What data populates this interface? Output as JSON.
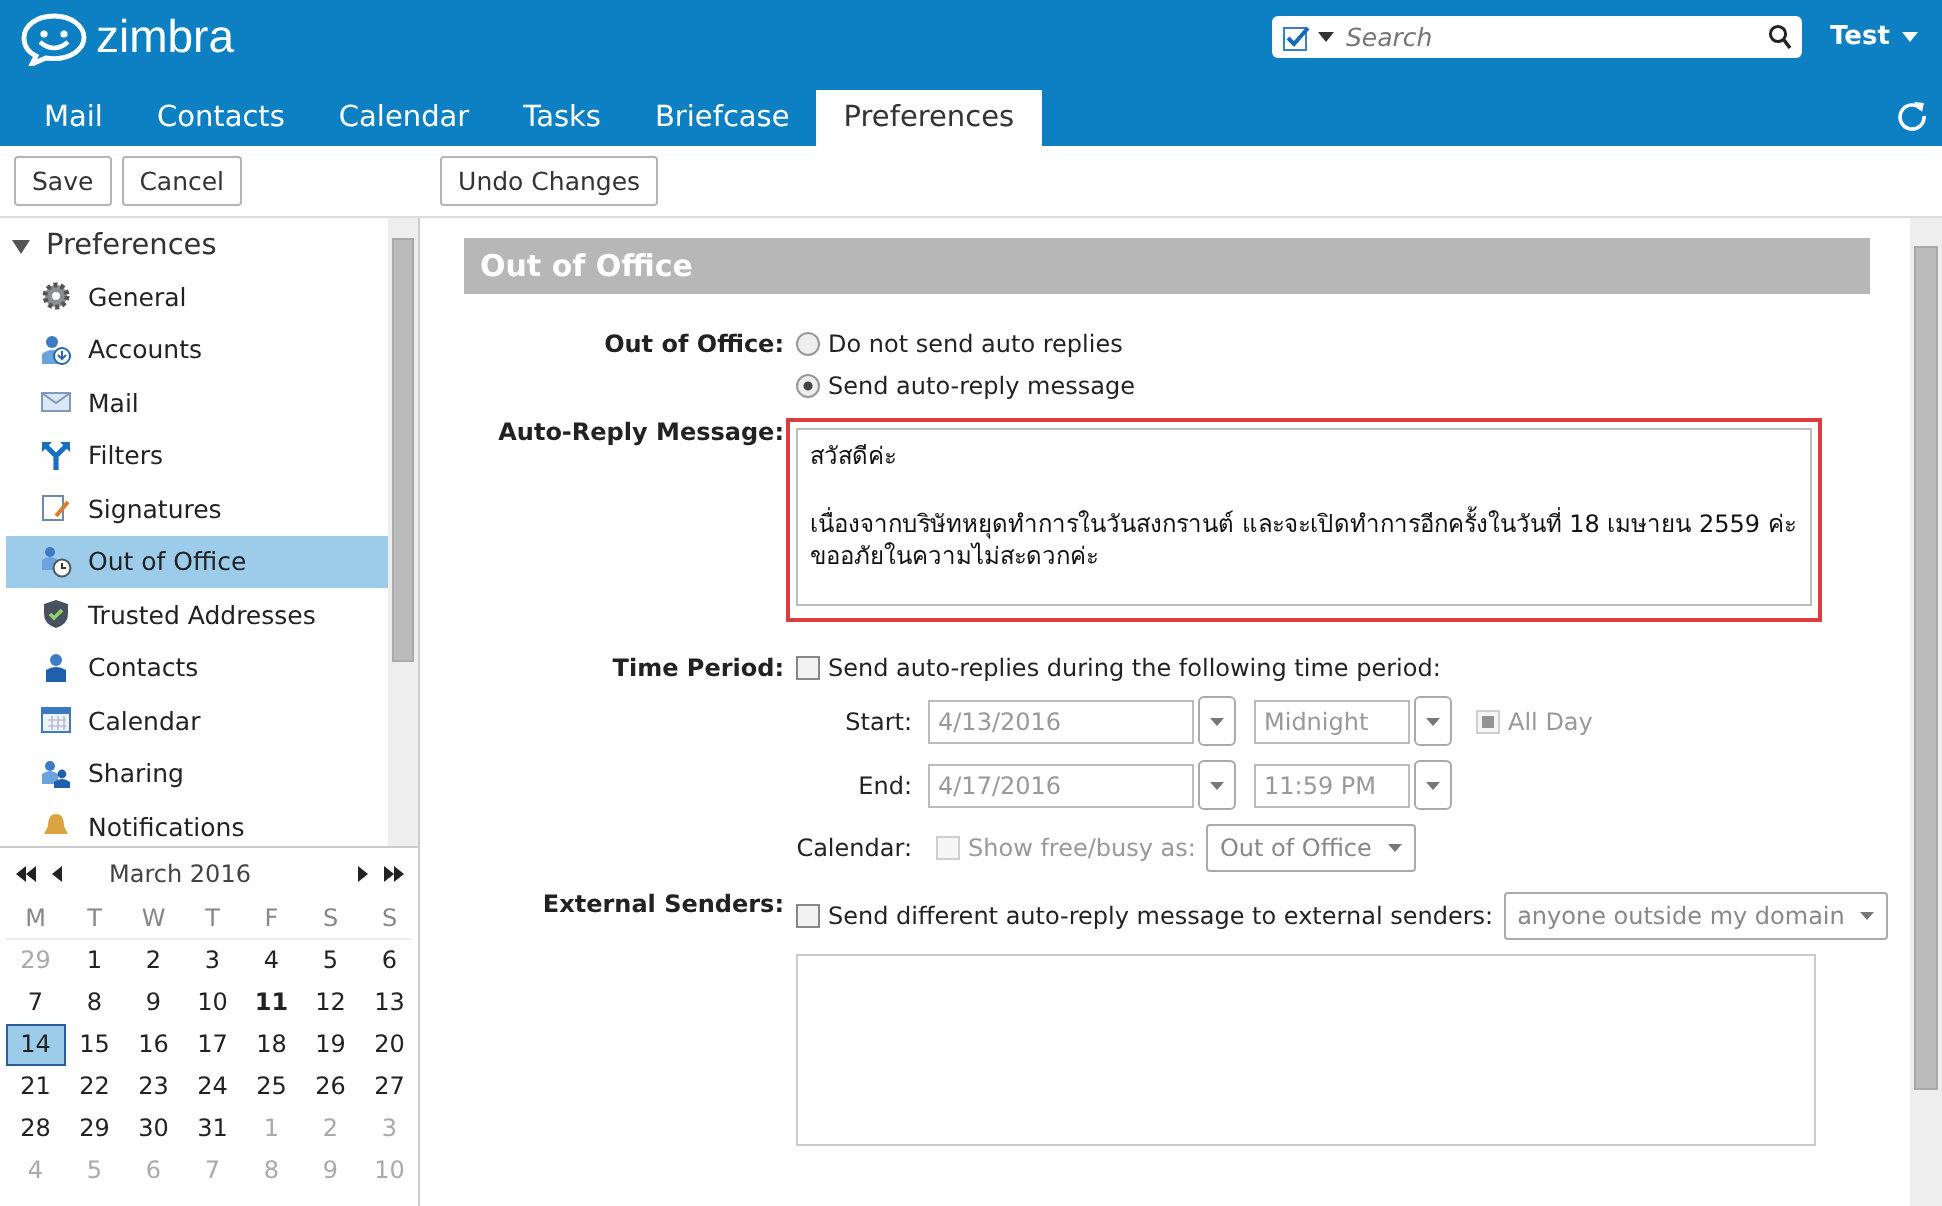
{
  "header": {
    "logo": "zimbra",
    "search": {
      "placeholder": "Search"
    },
    "user": "Test"
  },
  "tabs": [
    {
      "label": "Mail",
      "selected": false
    },
    {
      "label": "Contacts",
      "selected": false
    },
    {
      "label": "Calendar",
      "selected": false
    },
    {
      "label": "Tasks",
      "selected": false
    },
    {
      "label": "Briefcase",
      "selected": false
    },
    {
      "label": "Preferences",
      "selected": true
    }
  ],
  "toolbar": {
    "buttons": [
      "Save",
      "Cancel"
    ],
    "undo": "Undo Changes"
  },
  "sidebar": {
    "title": "Preferences",
    "expanded": true,
    "items": [
      {
        "label": "General",
        "selected": false
      },
      {
        "label": "Accounts",
        "selected": false
      },
      {
        "label": "Mail",
        "selected": false
      },
      {
        "label": "Filters",
        "selected": false
      },
      {
        "label": "Signatures",
        "selected": false
      },
      {
        "label": "Out of Office",
        "selected": true
      },
      {
        "label": "Trusted Addresses",
        "selected": false
      },
      {
        "label": "Contacts",
        "selected": false
      },
      {
        "label": "Calendar",
        "selected": false
      },
      {
        "label": "Sharing",
        "selected": false
      },
      {
        "label": "Notifications",
        "selected": false
      }
    ]
  },
  "mini_calendar": {
    "title": "March 2016",
    "weekdays": [
      "M",
      "T",
      "W",
      "T",
      "F",
      "S",
      "S"
    ],
    "weeks": [
      [
        {
          "day": "29",
          "muted": true,
          "today": false,
          "selected": false
        },
        {
          "day": "1",
          "muted": false,
          "today": false,
          "selected": false
        },
        {
          "day": "2",
          "muted": false,
          "today": false,
          "selected": false
        },
        {
          "day": "3",
          "muted": false,
          "today": false,
          "selected": false
        },
        {
          "day": "4",
          "muted": false,
          "today": false,
          "selected": false
        },
        {
          "day": "5",
          "muted": false,
          "today": false,
          "selected": false
        },
        {
          "day": "6",
          "muted": false,
          "today": false,
          "selected": false
        }
      ],
      [
        {
          "day": "7",
          "muted": false,
          "today": false,
          "selected": false
        },
        {
          "day": "8",
          "muted": false,
          "today": false,
          "selected": false
        },
        {
          "day": "9",
          "muted": false,
          "today": false,
          "selected": false
        },
        {
          "day": "10",
          "muted": false,
          "today": false,
          "selected": false
        },
        {
          "day": "11",
          "muted": false,
          "today": true,
          "selected": false
        },
        {
          "day": "12",
          "muted": false,
          "today": false,
          "selected": false
        },
        {
          "day": "13",
          "muted": false,
          "today": false,
          "selected": false
        }
      ],
      [
        {
          "day": "14",
          "muted": false,
          "today": false,
          "selected": true
        },
        {
          "day": "15",
          "muted": false,
          "today": false,
          "selected": false
        },
        {
          "day": "16",
          "muted": false,
          "today": false,
          "selected": false
        },
        {
          "day": "17",
          "muted": false,
          "today": false,
          "selected": false
        },
        {
          "day": "18",
          "muted": false,
          "today": false,
          "selected": false
        },
        {
          "day": "19",
          "muted": false,
          "today": false,
          "selected": false
        },
        {
          "day": "20",
          "muted": false,
          "today": false,
          "selected": false
        }
      ],
      [
        {
          "day": "21",
          "muted": false,
          "today": false,
          "selected": false
        },
        {
          "day": "22",
          "muted": false,
          "today": false,
          "selected": false
        },
        {
          "day": "23",
          "muted": false,
          "today": false,
          "selected": false
        },
        {
          "day": "24",
          "muted": false,
          "today": false,
          "selected": false
        },
        {
          "day": "25",
          "muted": false,
          "today": false,
          "selected": false
        },
        {
          "day": "26",
          "muted": false,
          "today": false,
          "selected": false
        },
        {
          "day": "27",
          "muted": false,
          "today": false,
          "selected": false
        }
      ],
      [
        {
          "day": "28",
          "muted": false,
          "today": false,
          "selected": false
        },
        {
          "day": "29",
          "muted": false,
          "today": false,
          "selected": false
        },
        {
          "day": "30",
          "muted": false,
          "today": false,
          "selected": false
        },
        {
          "day": "31",
          "muted": false,
          "today": false,
          "selected": false
        },
        {
          "day": "1",
          "muted": true,
          "today": false,
          "selected": false
        },
        {
          "day": "2",
          "muted": true,
          "today": false,
          "selected": false
        },
        {
          "day": "3",
          "muted": true,
          "today": false,
          "selected": false
        }
      ],
      [
        {
          "day": "4",
          "muted": true,
          "today": false,
          "selected": false
        },
        {
          "day": "5",
          "muted": true,
          "today": false,
          "selected": false
        },
        {
          "day": "6",
          "muted": true,
          "today": false,
          "selected": false
        },
        {
          "day": "7",
          "muted": true,
          "today": false,
          "selected": false
        },
        {
          "day": "8",
          "muted": true,
          "today": false,
          "selected": false
        },
        {
          "day": "9",
          "muted": true,
          "today": false,
          "selected": false
        },
        {
          "day": "10",
          "muted": true,
          "today": false,
          "selected": false
        }
      ]
    ]
  },
  "section": {
    "title": "Out of Office"
  },
  "out_of_office": {
    "label": "Out of Office:",
    "options": [
      {
        "label": "Do not send auto replies",
        "selected": false
      },
      {
        "label": "Send auto-reply message",
        "selected": true
      }
    ]
  },
  "auto_reply": {
    "label": "Auto-Reply Message:",
    "value": "สวัสดีค่ะ\n\nเนื่องจากบริษัทหยุดทำการในวันสงกรานต์ และจะเปิดทำการอีกครั้งในวันที่ 18 เมษายน 2559 ค่ะ\nขออภัยในความไม่สะดวกค่ะ"
  },
  "time_period": {
    "label": "Time Period:",
    "checkbox": {
      "label": "Send auto-replies during the following time period:",
      "checked": false
    },
    "start": {
      "label": "Start:",
      "date": "4/13/2016",
      "time": "Midnight",
      "disabled": true
    },
    "end": {
      "label": "End:",
      "date": "4/17/2016",
      "time": "11:59 PM",
      "disabled": true
    },
    "all_day": {
      "label": "All Day",
      "checked": true,
      "disabled": true
    },
    "calendar": {
      "label": "Calendar:",
      "checkbox": {
        "label": "Show free/busy as:",
        "checked": false,
        "disabled": true
      },
      "select": "Out of Office"
    }
  },
  "external_senders": {
    "label": "External Senders:",
    "checkbox": {
      "label": "Send different auto-reply message to external senders:",
      "checked": false
    },
    "select": "anyone outside my domain"
  }
}
